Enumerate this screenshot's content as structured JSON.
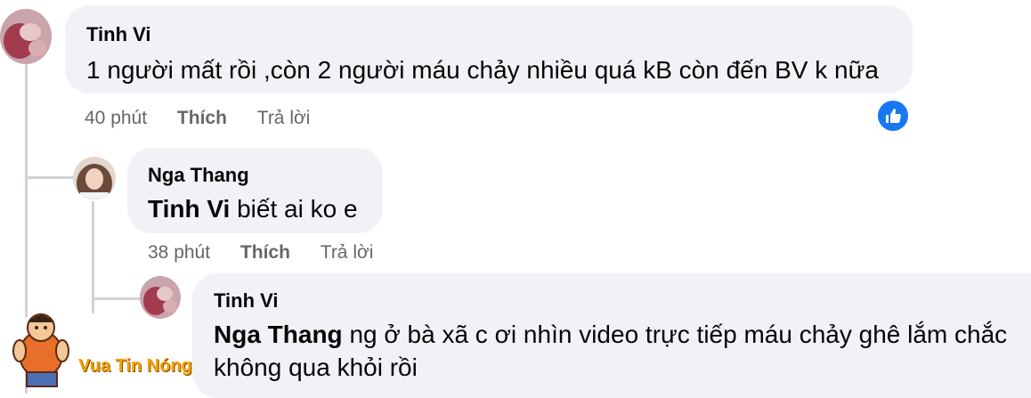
{
  "comments": [
    {
      "author": "Tinh Vi",
      "text": "1 người mất rồi ,còn 2 người máu chảy nhiều quá kB còn đến BV k nữa",
      "time": "40 phút",
      "like_label": "Thích",
      "reply_label": "Trả lời",
      "reaction_icon": "thumbs-up-icon"
    },
    {
      "author": "Nga Thang",
      "mention": "Tinh Vi",
      "text": " biết ai ko e",
      "time": "38 phút",
      "like_label": "Thích",
      "reply_label": "Trả lời"
    },
    {
      "author": "Tinh Vi",
      "mention": "Nga Thang",
      "text_line1": " ng ở bà xã c ơi nhìn video trực tiếp máu chảy ghê lắm chắc",
      "text_line2": "không qua khỏi rồi"
    }
  ],
  "watermark": {
    "text": "Vua Tin Nóng"
  },
  "colors": {
    "bubble": "#f0f2f5",
    "meta": "#65676b",
    "like_badge": "#1877f2",
    "watermark": "#f7a200"
  }
}
